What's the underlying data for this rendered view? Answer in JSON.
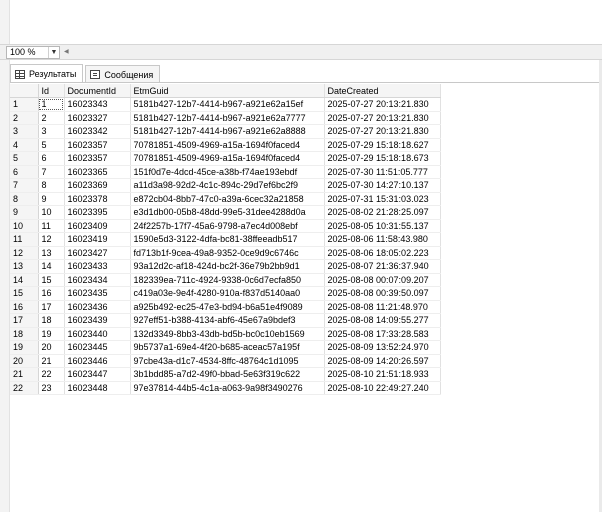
{
  "zoom": {
    "value": "100 %"
  },
  "tabs": [
    {
      "label": "Результаты",
      "icon": "grid-icon",
      "active": true
    },
    {
      "label": "Сообщения",
      "icon": "messages-icon",
      "active": false
    }
  ],
  "grid": {
    "columns": [
      "Id",
      "DocumentId",
      "EtmGuid",
      "DateCreated"
    ],
    "rows": [
      {
        "n": "1",
        "id": "1",
        "doc": "16023343",
        "guid": "5181b427-12b7-4414-b967-a921e62a15ef",
        "date": "2025-07-27 20:13:21.830"
      },
      {
        "n": "2",
        "id": "2",
        "doc": "16023327",
        "guid": "5181b427-12b7-4414-b967-a921e62a7777",
        "date": "2025-07-27 20:13:21.830"
      },
      {
        "n": "3",
        "id": "3",
        "doc": "16023342",
        "guid": "5181b427-12b7-4414-b967-a921e62a8888",
        "date": "2025-07-27 20:13:21.830"
      },
      {
        "n": "4",
        "id": "5",
        "doc": "16023357",
        "guid": "70781851-4509-4969-a15a-1694f0faced4",
        "date": "2025-07-29 15:18:18.627"
      },
      {
        "n": "5",
        "id": "6",
        "doc": "16023357",
        "guid": "70781851-4509-4969-a15a-1694f0faced4",
        "date": "2025-07-29 15:18:18.673"
      },
      {
        "n": "6",
        "id": "7",
        "doc": "16023365",
        "guid": "151f0d7e-4dcd-45ce-a38b-f74ae193ebdf",
        "date": "2025-07-30 11:51:05.777"
      },
      {
        "n": "7",
        "id": "8",
        "doc": "16023369",
        "guid": "a11d3a98-92d2-4c1c-894c-29d7ef6bc2f9",
        "date": "2025-07-30 14:27:10.137"
      },
      {
        "n": "8",
        "id": "9",
        "doc": "16023378",
        "guid": "e872cb04-8bb7-47c0-a39a-6cec32a21858",
        "date": "2025-07-31 15:31:03.023"
      },
      {
        "n": "9",
        "id": "10",
        "doc": "16023395",
        "guid": "e3d1db00-05b8-48dd-99e5-31dee4288d0a",
        "date": "2025-08-02 21:28:25.097"
      },
      {
        "n": "10",
        "id": "11",
        "doc": "16023409",
        "guid": "24f2257b-17f7-45a6-9798-a7ec4d008ebf",
        "date": "2025-08-05 10:31:55.137"
      },
      {
        "n": "11",
        "id": "12",
        "doc": "16023419",
        "guid": "1590e5d3-3122-4dfa-bc81-38ffeeadb517",
        "date": "2025-08-06 11:58:43.980"
      },
      {
        "n": "12",
        "id": "13",
        "doc": "16023427",
        "guid": "fd713b1f-9cea-49a8-9352-0ce9d9c6746c",
        "date": "2025-08-06 18:05:02.223"
      },
      {
        "n": "13",
        "id": "14",
        "doc": "16023433",
        "guid": "93a12d2c-af18-424d-bc2f-36e79b2bb9d1",
        "date": "2025-08-07 21:36:37.940"
      },
      {
        "n": "14",
        "id": "15",
        "doc": "16023434",
        "guid": "182339ea-711c-4924-9338-0c6d7ecfa850",
        "date": "2025-08-08 00:07:09.207"
      },
      {
        "n": "15",
        "id": "16",
        "doc": "16023435",
        "guid": "c419a03e-9e4f-4280-910a-f837d5140aa0",
        "date": "2025-08-08 00:39:50.097"
      },
      {
        "n": "16",
        "id": "17",
        "doc": "16023436",
        "guid": "a925b492-ec25-47e3-bd94-b6a51e4f9089",
        "date": "2025-08-08 11:21:48.970"
      },
      {
        "n": "17",
        "id": "18",
        "doc": "16023439",
        "guid": "927eff51-b388-4134-abf6-45e67a9bdef3",
        "date": "2025-08-08 14:09:55.277"
      },
      {
        "n": "18",
        "id": "19",
        "doc": "16023440",
        "guid": "132d3349-8bb3-43db-bd5b-bc0c10eb1569",
        "date": "2025-08-08 17:33:28.583"
      },
      {
        "n": "19",
        "id": "20",
        "doc": "16023445",
        "guid": "9b5737a1-69e4-4f20-b685-aceac57a195f",
        "date": "2025-08-09 13:52:24.970"
      },
      {
        "n": "20",
        "id": "21",
        "doc": "16023446",
        "guid": "97cbe43a-d1c7-4534-8ffc-48764c1d1095",
        "date": "2025-08-09 14:20:26.597"
      },
      {
        "n": "21",
        "id": "22",
        "doc": "16023447",
        "guid": "3b1bdd85-a7d2-49f0-bbad-5e63f319c622",
        "date": "2025-08-10 21:51:18.933"
      },
      {
        "n": "22",
        "id": "23",
        "doc": "16023448",
        "guid": "97e37814-44b5-4c1a-a063-9a98f3490276",
        "date": "2025-08-10 22:49:27.240"
      }
    ]
  }
}
